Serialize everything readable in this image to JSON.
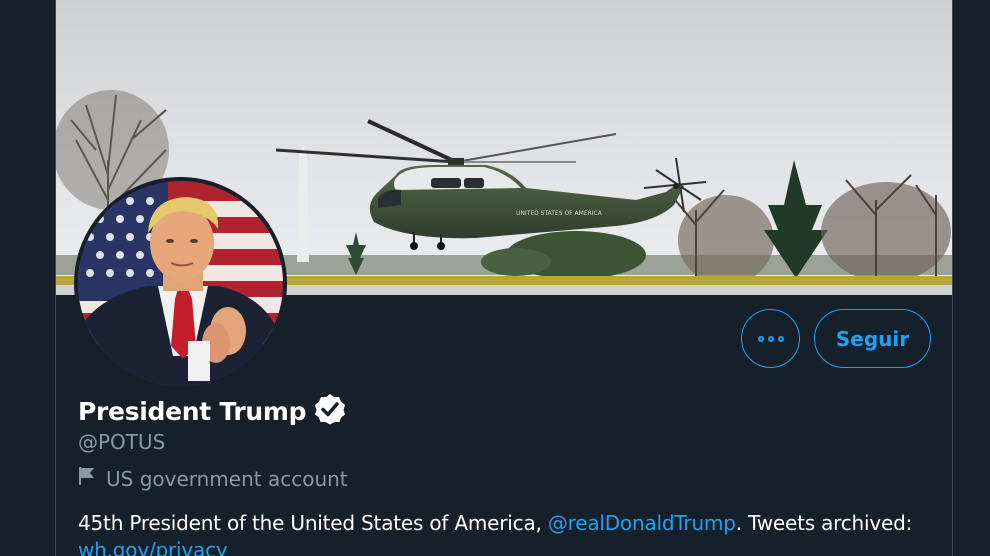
{
  "profile": {
    "name": "President Trump",
    "handle": "@POTUS",
    "label": "US government account",
    "bio_text_1": "45th President of the United States of America, ",
    "bio_mention": "@realDonaldTrump",
    "bio_text_2": ". Tweets archived: ",
    "bio_link": "wh.gov/privacy",
    "helicopter_text": "UNITED STATES OF AMERICA"
  },
  "actions": {
    "more_label": "More",
    "follow_label": "Seguir"
  },
  "icons": {
    "verified": "verified-badge-icon",
    "flag": "flag-icon",
    "more": "more-dots-icon"
  },
  "colors": {
    "background": "#15202b",
    "accent": "#1da1f2",
    "secondary_text": "#8899a6"
  }
}
